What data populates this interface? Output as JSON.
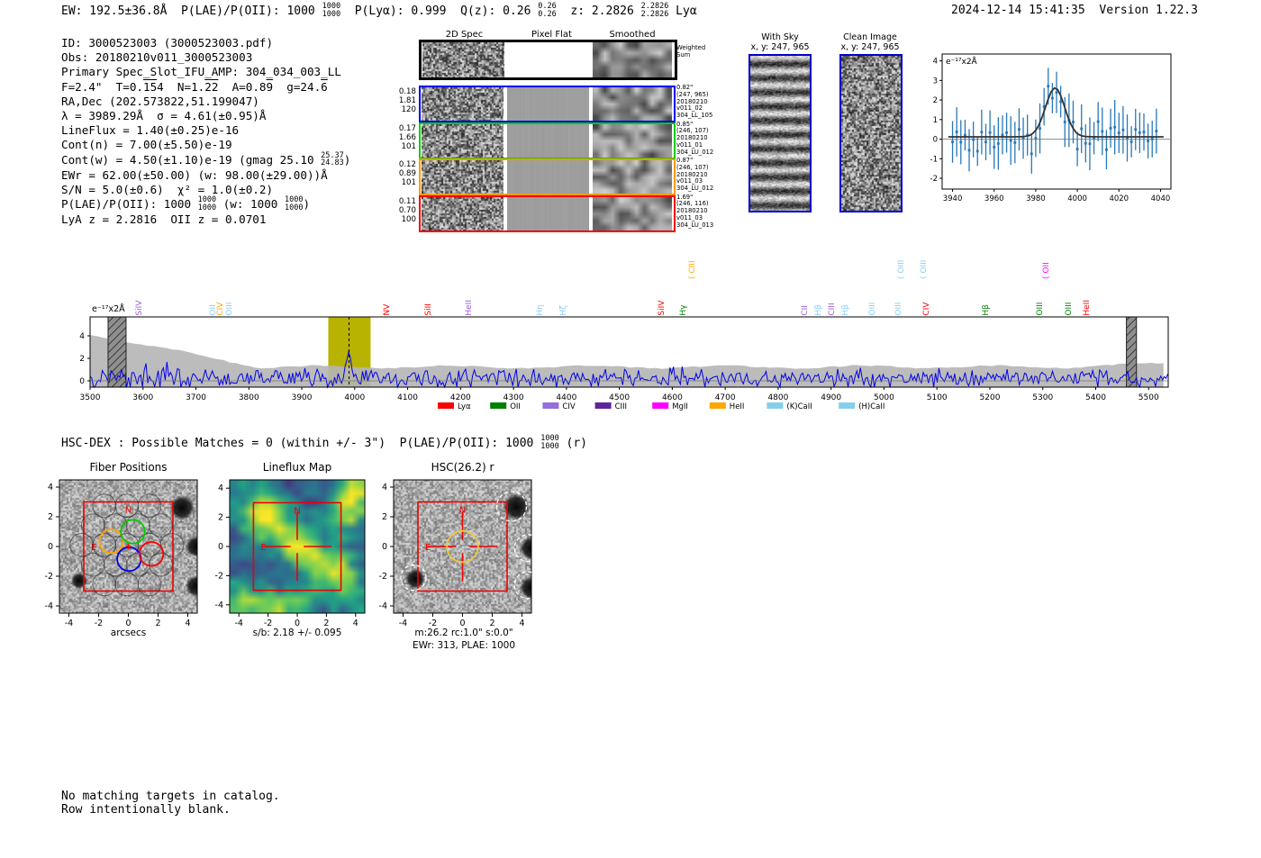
{
  "header": {
    "left_segments": [
      {
        "t": "EW: 192.5±36.8Å  P(LAE)/P(OII): 1000 "
      },
      {
        "hi": "1000",
        "lo": "1000"
      },
      {
        "t": "  P(Lyα): 0.999  Q(z): 0.26 "
      },
      {
        "hi": "0.26",
        "lo": "0.26"
      },
      {
        "t": "  z: 2.2826 "
      },
      {
        "hi": "2.2826",
        "lo": "2.2826"
      },
      {
        "t": " Lyα"
      }
    ],
    "timestamp": "2024-12-14 15:41:35",
    "version": "Version 1.22.3"
  },
  "info": {
    "lines": [
      [
        {
          "t": "ID: 3000523003 (3000523003.pdf)"
        }
      ],
      [
        {
          "t": "Obs: 20180210v011_3000523003"
        }
      ],
      [
        {
          "t": "Primary Spec_Slot_IFU_AMP: 304_034_003_LL"
        }
      ],
      [
        {
          "t": "F=2.4\"  T=0."
        },
        {
          "t": "15",
          "ov": true
        },
        {
          "t": "4  N=1."
        },
        {
          "t": "22",
          "ov": true
        },
        {
          "t": "  A=0.8"
        },
        {
          "t": "9",
          "ov": true
        },
        {
          "t": "  g=24."
        },
        {
          "t": "6",
          "ov": true
        }
      ],
      [
        {
          "t": "RA,Dec (202.573822,51.199047)"
        }
      ],
      [
        {
          "t": "λ = 3989.29Å  σ = 4.61(±0.95)Å"
        }
      ],
      [
        {
          "t": "LineFlux = 1.40(±0.25)e-16"
        }
      ],
      [
        {
          "t": "Cont(n) = 7.00(±5.50)e-19"
        }
      ],
      [
        {
          "t": "Cont(w) = 4.50(±1.10)e-19 (gmag 25.10 "
        },
        {
          "hi": "25.37",
          "lo": "24.83"
        },
        {
          "t": ")"
        }
      ],
      [
        {
          "t": "EWr = 62.00(±50.00) (w: 98.00(±29.00))Å"
        }
      ],
      [
        {
          "t": "S/N = 5.0(±0.6)  χ² = 1.0(±0.2)"
        }
      ],
      [
        {
          "t": "P(LAE)/P(OII): 1000 "
        },
        {
          "hi": "1000",
          "lo": "1000"
        },
        {
          "t": " (w: 1000 "
        },
        {
          "hi": "1000",
          "lo": "1000"
        },
        {
          "t": ")"
        }
      ],
      [
        {
          "t": "LyA z = 2.2816  OII z = 0.0701"
        }
      ]
    ]
  },
  "cutouts2d": {
    "col_titles": [
      "2D Spec",
      "Pixel Flat",
      "Smoothed"
    ],
    "weighted_sum_label": "Weighted\nSum",
    "rows": [
      {
        "border": "#0000ee",
        "left": [
          "0.18",
          "1.81",
          "120"
        ],
        "right": [
          "0.82\"",
          "(247, 965)",
          "20180210",
          "v011_02",
          "304_LL_105"
        ]
      },
      {
        "border": "#00cc00",
        "left": [
          "0.17",
          "1.66",
          "101"
        ],
        "right": [
          "0.85\"",
          "(246, 107)",
          "20180210",
          "v011_01",
          "304_LU_012"
        ]
      },
      {
        "border": "#ff9900",
        "left": [
          "0.12",
          "0.89",
          "101"
        ],
        "right": [
          "0.87\"",
          "(246, 107)",
          "20180210",
          "v011_03",
          "304_LU_012"
        ]
      },
      {
        "border": "#ee0000",
        "left": [
          "0.11",
          "0.70",
          "100"
        ],
        "right": [
          "1.69\"",
          "(246, 116)",
          "20180210",
          "v011_03",
          "304_LU_013"
        ]
      }
    ]
  },
  "sky_panels": [
    {
      "title": "With Sky",
      "coords": "x, y: 247, 965"
    },
    {
      "title": "Clean Image",
      "coords": "x, y: 247, 965"
    }
  ],
  "hsc": {
    "line_segments": [
      {
        "t": "HSC-DEX : Possible Matches = 0 (within +/- 3\")  P(LAE)/P(OII): 1000 "
      },
      {
        "hi": "1000",
        "lo": "1000"
      },
      {
        "t": " (r)"
      }
    ]
  },
  "footer": {
    "lines": [
      "No matching targets in catalog.",
      "Row intentionally blank."
    ]
  },
  "chart_data": [
    {
      "id": "line_fit_inset",
      "type": "scatter",
      "annotation": "e⁻¹⁷x2Å",
      "xlim": [
        3935,
        4045
      ],
      "ylim": [
        -2.55,
        4.35
      ],
      "xticks": [
        3940,
        3960,
        3980,
        4000,
        4020,
        4040
      ],
      "yticks": [
        4,
        3,
        2,
        1,
        0,
        -1,
        -2
      ],
      "gaussian_fit": {
        "center": 3989.29,
        "sigma": 4.61,
        "amplitude": 2.5,
        "baseline": 0.12
      },
      "point_color": "#2878b8",
      "fit_color": "#333333",
      "grid": false,
      "legend_position": "none"
    },
    {
      "id": "full_spectrum",
      "type": "line",
      "annotation": "e⁻¹⁷x2Å",
      "xlim": [
        3500,
        5537
      ],
      "ylim": [
        -0.56,
        5.68
      ],
      "xticks": [
        3500,
        3600,
        3700,
        3800,
        3900,
        4000,
        4100,
        4200,
        4300,
        4400,
        4500,
        4600,
        4700,
        4800,
        4900,
        5000,
        5100,
        5200,
        5300,
        5400,
        5500
      ],
      "yticks": [
        0,
        2,
        4
      ],
      "line_color": "#0000ee",
      "error_band_color": "#b5b5b5",
      "signal_region": {
        "x0": 3950,
        "x1": 4030,
        "color": "#b8b200",
        "dashed_center": 3989.29
      },
      "masked_regions": [
        [
          3534,
          3568
        ],
        [
          5458,
          5477
        ]
      ],
      "emission_peak": {
        "center": 3989.29,
        "sigma": 4.8,
        "amplitude": 2.6
      },
      "emission_labels": [
        {
          "wave": 3602,
          "text": "SiIV",
          "color": "#9b59d6",
          "row": "low"
        },
        {
          "wave": 3742,
          "text": "OII",
          "color": "#87CEFA",
          "row": "low"
        },
        {
          "wave": 3756,
          "text": "CIV",
          "color": "#FFA500",
          "row": "low"
        },
        {
          "wave": 3773,
          "text": "OIII",
          "color": "#87CEFA",
          "row": "low"
        },
        {
          "wave": 4070,
          "text": "NV",
          "color": "#ff0000",
          "row": "low"
        },
        {
          "wave": 4149,
          "text": "SiII",
          "color": "#ff0000",
          "row": "low"
        },
        {
          "wave": 4225,
          "text": "HeII",
          "color": "#9b59d6",
          "row": "low"
        },
        {
          "wave": 4360,
          "text": "Hη",
          "color": "#87CEFA",
          "row": "low"
        },
        {
          "wave": 4403,
          "text": "Hζ",
          "color": "#87CEFA",
          "row": "low"
        },
        {
          "wave": 4589,
          "text": "SiIV",
          "color": "#ff0000",
          "row": "low"
        },
        {
          "wave": 4630,
          "text": "Hγ",
          "color": "#008000",
          "row": "low"
        },
        {
          "wave": 4647,
          "text": "CIII",
          "color": "#FFA500",
          "row": "high"
        },
        {
          "wave": 4860,
          "text": "CII",
          "color": "#9b59d6",
          "row": "low"
        },
        {
          "wave": 4886,
          "text": "Hβ",
          "color": "#87CEFA",
          "row": "low"
        },
        {
          "wave": 4911,
          "text": "CIII",
          "color": "#9b59d6",
          "row": "low"
        },
        {
          "wave": 4937,
          "text": "Hβ",
          "color": "#87CEFA",
          "row": "low"
        },
        {
          "wave": 4988,
          "text": "OIII",
          "color": "#87CEFA",
          "row": "low"
        },
        {
          "wave": 5036,
          "text": "OIII",
          "color": "#87CEFA",
          "row": "low"
        },
        {
          "wave": 5042,
          "text": "OIII",
          "color": "#87CEFA",
          "row": "high"
        },
        {
          "wave": 5085,
          "text": "OIII",
          "color": "#87CEFA",
          "row": "high"
        },
        {
          "wave": 5090,
          "text": "CIV",
          "color": "#ff0000",
          "row": "low"
        },
        {
          "wave": 5201,
          "text": "Hβ",
          "color": "#008000",
          "row": "low"
        },
        {
          "wave": 5304,
          "text": "OIII",
          "color": "#008000",
          "row": "low"
        },
        {
          "wave": 5316,
          "text": "OII",
          "color": "#ff00ff",
          "row": "high"
        },
        {
          "wave": 5358,
          "text": "OIII",
          "color": "#008000",
          "row": "low"
        },
        {
          "wave": 5392,
          "text": "HeII",
          "color": "#ff0000",
          "row": "low"
        }
      ],
      "legend": [
        {
          "label": "Lyα",
          "color": "#ff0000"
        },
        {
          "label": "OII",
          "color": "#008000"
        },
        {
          "label": "CIV",
          "color": "#9370DB"
        },
        {
          "label": "CIII",
          "color": "#5e239d"
        },
        {
          "label": "MgII",
          "color": "#ff00ff"
        },
        {
          "label": "HeII",
          "color": "#FFA500"
        },
        {
          "label": "(K)CaII",
          "color": "#87CEEB"
        },
        {
          "label": "(H)CaII",
          "color": "#87CEEB"
        }
      ],
      "legend_position": "below",
      "grid": false
    }
  ],
  "panels_bottom": {
    "ticks": [
      -4,
      -2,
      0,
      2,
      4
    ],
    "compass": {
      "n": "N",
      "e": "E"
    },
    "panels": [
      {
        "title": "Fiber Positions",
        "xlabel": "arcsecs"
      },
      {
        "title": "Lineflux Map",
        "xlabel": "s/b: 2.18 +/- 0.095"
      },
      {
        "title": "HSC(26.2) r",
        "xlabel": "m:26.2 rc:1.0\"  s:0.0\"",
        "xlabel2": "EWr: 313, PLAE: 1000"
      }
    ]
  },
  "colors": {
    "accent_red": "#ee0000",
    "fiber_orange": "#FFA500",
    "fiber_green": "#00cc00",
    "fiber_blue": "#0000ee",
    "fiber_red": "#ff0000",
    "hsc_circle_yellow": "#f0c83c"
  }
}
